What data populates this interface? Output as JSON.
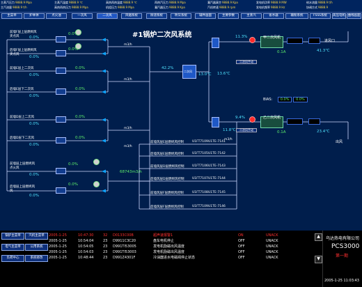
{
  "status_bar": [
    {
      "label": "主蒸汽压力",
      "value": "9888.9 Mpa"
    },
    {
      "label": "主蒸汽温度",
      "value": "9888.9 ℃"
    },
    {
      "label": "高热再热温度",
      "value": "9888.9 ℃"
    },
    {
      "label": "再热汽压力",
      "value": "9888.9 Mpa"
    },
    {
      "label": "凝汽器真空",
      "value": "9888.9 Kpa"
    },
    {
      "label": "发电机功率",
      "value": "9888.9 MW"
    },
    {
      "label": "给水流量",
      "value": "9888.9 t/h"
    },
    {
      "label": "主汽流量",
      "value": "9888.9 t/h"
    },
    {
      "label": "高热再热压力",
      "value": "9888.9 Mpa"
    },
    {
      "label": "机组压力",
      "value": "9888.9 Mpa"
    },
    {
      "label": "凝汽器压力",
      "value": "9888.9 Kpa"
    },
    {
      "label": "汽机转速",
      "value": "9888.9 rpm"
    },
    {
      "label": "发电机频率",
      "value": "9888.9 Hz"
    },
    {
      "label": "协调方式",
      "value": "9888.9"
    }
  ],
  "nav_tabs": [
    "主菜单",
    "炉本体",
    "点火油",
    "一次风",
    "二次风",
    "风烟系统",
    "除渣系统",
    "吹灰系统",
    "辅件画面",
    "",
    "主要参数",
    "主蒸汽",
    "省水器",
    "输粉系统",
    "FSSS系统",
    "高压电机",
    "曲线画面"
  ],
  "active_tab": "二次风",
  "title": "#1锅炉二次风系统",
  "left_feeds": [
    {
      "name": "前墙F层上层燃烬风",
      "sub": "夹点风",
      "v1": "0.0%",
      "v2": "0.0%"
    },
    {
      "name": "后墙F层上层燃烬风",
      "sub": "夹点风",
      "v1": "0.0%",
      "v2": "0.0%"
    },
    {
      "name": "前墙E层上二次风",
      "sub": "",
      "v1": "0.0%",
      "v2": "0.0%"
    },
    {
      "name": "后墙E层下二次风",
      "sub": "",
      "v1": "0.0%",
      "v2": "0.0%"
    },
    {
      "name": "前墙D层上二次风",
      "sub": "",
      "v1": "0.0%",
      "v2": "0.0%"
    },
    {
      "name": "后墙D层下二次风",
      "sub": "",
      "v1": "0.0%",
      "v2": "0.0%"
    },
    {
      "name": "前墙层上层燃烬风",
      "sub": "点火风",
      "v1": "0.0%",
      "v2": "0.0%"
    },
    {
      "name": "后墙层上层燃烬风",
      "sub": "风",
      "v1": "0.0%",
      "v2": "0.0%"
    }
  ],
  "flow_units": [
    "m3/h",
    "m3/h",
    "m3/h",
    "m3/h",
    "m3/h"
  ],
  "flow_total": "68743m3/h",
  "center_pct": "42.2%",
  "center_temp": "13.0℃",
  "right_top_pct": "11.3%",
  "right_top_temp": "13.6℃",
  "bottom_pct": "9.4%",
  "bottom_temp": "11.8℃",
  "center_box_label": "二次风",
  "fan_top": {
    "name": "甲二次风机",
    "flow": "0.1A",
    "temp": "41.3℃",
    "outlet": "进风口",
    "status": "二次风手动"
  },
  "fan_bottom": {
    "name": "乙二次风机",
    "flow": "0.1A",
    "temp": "23.4℃",
    "outlet": "出风",
    "status": "二次风手动"
  },
  "bias": {
    "label": "BIAS:",
    "v1": "0.0%",
    "v2": "0.0%"
  },
  "bottom_flow_unit": "m3/h",
  "dampers": [
    {
      "name": "前墙风层E层燃烬风控制",
      "code": "U1FT7109",
      "tag": "U1TE-7141"
    },
    {
      "name": "后墙风层E层燃烬风控制",
      "code": "U1FT7105",
      "tag": "U1TE-7142"
    },
    {
      "name": "前墙风层D层燃烬风控制",
      "code": "U1FT7106",
      "tag": "U1TE-7143"
    },
    {
      "name": "后墙风层D层燃烬风控制",
      "code": "U1FT7107",
      "tag": "U1TE-7144"
    },
    {
      "name": "前墙风层F层燃烬风控制",
      "code": "U1FT7108",
      "tag": "U1TE-7145"
    },
    {
      "name": "后墙风层F层燃烬风控制",
      "code": "U1FT7109",
      "tag": "U1TE-7146"
    }
  ],
  "left_buttons": [
    [
      "锅炉主菜单",
      "汽机主菜单"
    ],
    [
      "电气主菜单",
      "公用系统"
    ],
    [
      "负荷中心",
      "系统修改"
    ]
  ],
  "alarms": [
    {
      "date": "2005-1-25",
      "time": "10:47:30",
      "p": "32",
      "code": "D0133C00B",
      "desc": "超声速报警1",
      "state": "ON",
      "ack": "UNACK"
    },
    {
      "date": "2005-1-25",
      "time": "10:54:04",
      "p": "23",
      "code": "D9911C3C20",
      "desc": "盘车电机停止",
      "state": "OFF",
      "ack": "UNACK"
    },
    {
      "date": "2005-1-25",
      "time": "10:54:05",
      "p": "23",
      "code": "D991TI53005",
      "desc": "发电机励磁出风温度",
      "state": "OFF",
      "ack": "UNACK"
    },
    {
      "date": "2005-1-25",
      "time": "10:54:03",
      "p": "23",
      "code": "D991TI53003",
      "desc": "发电机励磁出风温度",
      "state": "OFF",
      "ack": "UNACK"
    },
    {
      "date": "2005-1-25",
      "time": "10:48:44",
      "p": "23",
      "code": "D991Z4301F",
      "desc": "冷油器进水电磁阀停止状态",
      "state": "OFF",
      "ack": "UNACK"
    }
  ],
  "brand": {
    "company": "乌达热电有限公司",
    "product": "PCS3000",
    "unit": "第一期",
    "datetime": "2005-1-25 11:03:43"
  }
}
